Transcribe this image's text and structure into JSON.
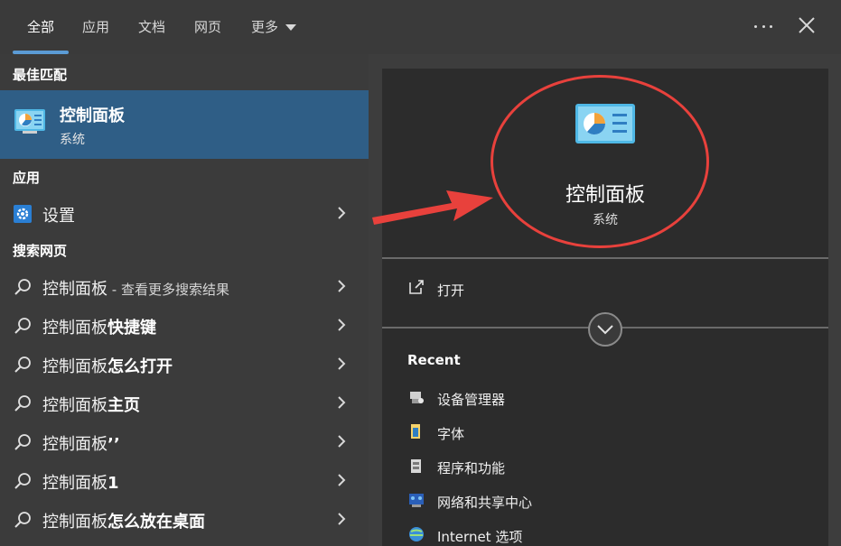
{
  "tabs": [
    {
      "label": "全部"
    },
    {
      "label": "应用"
    },
    {
      "label": "文档"
    },
    {
      "label": "网页"
    }
  ],
  "more_label": "更多",
  "colors": {
    "accent": "#5b9bd5",
    "selection": "#2f5e86",
    "annotation": "#e8413c"
  },
  "left": {
    "best_match_header": "最佳匹配",
    "best_match": {
      "title": "控制面板",
      "subtitle": "系统",
      "icon": "control-panel-icon"
    },
    "apps_header": "应用",
    "apps": [
      {
        "label": "设置",
        "icon": "gear-icon"
      }
    ],
    "web_header": "搜索网页",
    "web": [
      {
        "prefix": "控制面板",
        "bold": "",
        "hint": " - 查看更多搜索结果"
      },
      {
        "prefix": "控制面板",
        "bold": "快捷键",
        "hint": ""
      },
      {
        "prefix": "控制面板",
        "bold": "怎么打开",
        "hint": ""
      },
      {
        "prefix": "控制面板",
        "bold": "主页",
        "hint": ""
      },
      {
        "prefix": "控制面板",
        "bold": "’’",
        "hint": ""
      },
      {
        "prefix": "控制面板",
        "bold": "1",
        "hint": ""
      },
      {
        "prefix": "控制面板",
        "bold": "怎么放在桌面",
        "hint": ""
      }
    ]
  },
  "right": {
    "title": "控制面板",
    "subtitle": "系统",
    "open_label": "打开",
    "recent_header": "Recent",
    "recent": [
      {
        "label": "设备管理器",
        "icon": "device-manager-icon"
      },
      {
        "label": "字体",
        "icon": "fonts-icon"
      },
      {
        "label": "程序和功能",
        "icon": "programs-icon"
      },
      {
        "label": "网络和共享中心",
        "icon": "network-icon"
      },
      {
        "label": "Internet 选项",
        "icon": "internet-options-icon"
      }
    ]
  }
}
